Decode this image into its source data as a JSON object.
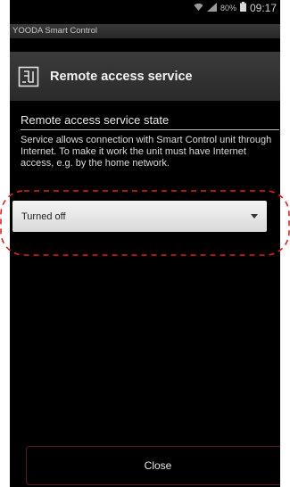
{
  "status_bar": {
    "battery_percent": "80%",
    "time": "09:17",
    "icons": [
      "wifi-icon",
      "signal-icon",
      "battery-icon"
    ]
  },
  "app_bar": {
    "title": "YOODA Smart Control"
  },
  "header": {
    "icon": "remote-access-icon",
    "title": "Remote access service"
  },
  "section": {
    "title": "Remote access service state",
    "description": "Service allows connection with Smart Control unit through Internet. To make it work the unit must have Internet access, e.g. by the home network."
  },
  "state_select": {
    "selected": "Turned off"
  },
  "footer": {
    "close_label": "Close"
  },
  "colors": {
    "background": "#000000",
    "dropdown_bg": "#e6e6e6",
    "highlight_dash": "#e02020",
    "close_border": "#5a1a1a"
  }
}
